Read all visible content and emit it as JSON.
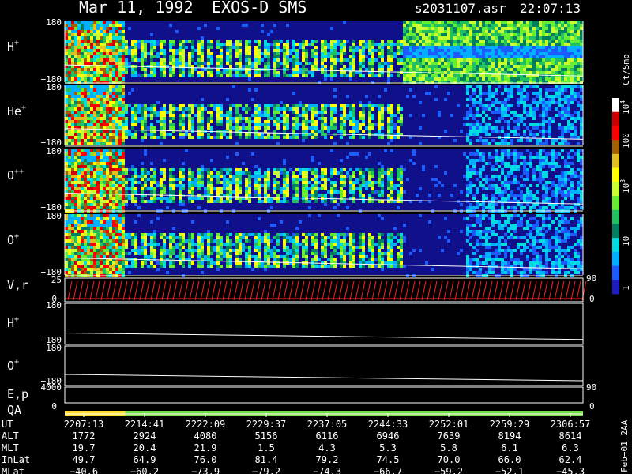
{
  "header": {
    "date": "Mar 11, 1992",
    "instrument": "EXOS-D SMS",
    "file": "s2031107.asr",
    "time": "22:07:13"
  },
  "colorbar": {
    "unit": "Ct/Smp",
    "tick_labels": [
      "10",
      "100",
      "10",
      "10",
      "1"
    ],
    "tick_exponents": [
      "4",
      "",
      "3",
      "",
      ""
    ],
    "tick_values": [
      10000,
      1000,
      100,
      10,
      1
    ],
    "colors": [
      "#1c1cc0",
      "#1c5cff",
      "#00b0ff",
      "#00dce0",
      "#008060",
      "#22c060",
      "#66ee33",
      "#c8ff33",
      "#ffff00",
      "#e0c020",
      "#a06000",
      "#ff0000",
      "#cc0000",
      "#ffffff"
    ]
  },
  "chart_data": [
    {
      "type": "heatmap",
      "name": "H+",
      "label_base": "H",
      "label_sup": "+",
      "ylim": [
        -180,
        180
      ],
      "y_ticks": [
        "180",
        "−180"
      ]
    },
    {
      "type": "heatmap",
      "name": "He+",
      "label_base": "He",
      "label_sup": "+",
      "ylim": [
        -180,
        180
      ],
      "y_ticks": [
        "180",
        "−180"
      ]
    },
    {
      "type": "heatmap",
      "name": "O++",
      "label_base": "O",
      "label_sup": "++",
      "ylim": [
        -180,
        180
      ],
      "y_ticks": [
        "180",
        "−180"
      ]
    },
    {
      "type": "heatmap",
      "name": "O+",
      "label_base": "O",
      "label_sup": "+",
      "ylim": [
        -180,
        180
      ],
      "y_ticks": [
        "180",
        "−180"
      ]
    },
    {
      "type": "line",
      "name": "V,r",
      "label_base": "V,r",
      "left_ticks": [
        "25",
        "0"
      ],
      "right_ticks": [
        "90",
        "0"
      ],
      "ylim": [
        0,
        25
      ]
    },
    {
      "type": "line",
      "name": "H+",
      "label_base": "H",
      "label_sup": "+",
      "ylim": [
        -180,
        180
      ],
      "y_ticks": [
        "180",
        "−180"
      ]
    },
    {
      "type": "line",
      "name": "O+",
      "label_base": "O",
      "label_sup": "+",
      "ylim": [
        -180,
        180
      ],
      "y_ticks": [
        "180",
        "−180"
      ]
    },
    {
      "type": "line",
      "name": "E,p",
      "label_base": "E,p",
      "left_ticks": [
        "4000"
      ],
      "right_ticks": [
        "90"
      ]
    },
    {
      "type": "bar",
      "name": "QA",
      "label_base": "QA",
      "left_ticks": [
        "0"
      ],
      "right_ticks": [
        "0"
      ],
      "segments": [
        {
          "start": "2207:13",
          "end": "2214:13",
          "color": "#ffe030"
        },
        {
          "start": "2214:13",
          "end": "2306:57",
          "color": "#77dd44"
        }
      ]
    }
  ],
  "orbit_table": {
    "row_labels": [
      "UT",
      "ALT",
      "MLT",
      "InLat",
      "MLat"
    ],
    "columns": [
      {
        "UT": "2207:13",
        "ALT": "1772",
        "MLT": "19.7",
        "InLat": "49.7",
        "MLat": "−40.6"
      },
      {
        "UT": "2214:41",
        "ALT": "2924",
        "MLT": "20.4",
        "InLat": "64.9",
        "MLat": "−60.2"
      },
      {
        "UT": "2222:09",
        "ALT": "4080",
        "MLT": "21.9",
        "InLat": "76.0",
        "MLat": "−73.9"
      },
      {
        "UT": "2229:37",
        "ALT": "5156",
        "MLT": "1.5",
        "InLat": "81.4",
        "MLat": "−79.2"
      },
      {
        "UT": "2237:05",
        "ALT": "6116",
        "MLT": "4.3",
        "InLat": "79.2",
        "MLat": "−74.3"
      },
      {
        "UT": "2244:33",
        "ALT": "6946",
        "MLT": "5.3",
        "InLat": "74.5",
        "MLat": "−66.7"
      },
      {
        "UT": "2252:01",
        "ALT": "7639",
        "MLT": "5.8",
        "InLat": "70.0",
        "MLat": "−59.2"
      },
      {
        "UT": "2259:29",
        "ALT": "8194",
        "MLT": "6.1",
        "InLat": "66.0",
        "MLat": "−52.1"
      },
      {
        "UT": "2306:57",
        "ALT": "8614",
        "MLT": "6.3",
        "InLat": "62.4",
        "MLat": "−45.3"
      }
    ]
  },
  "footer_note": "Feb−01 2AA"
}
